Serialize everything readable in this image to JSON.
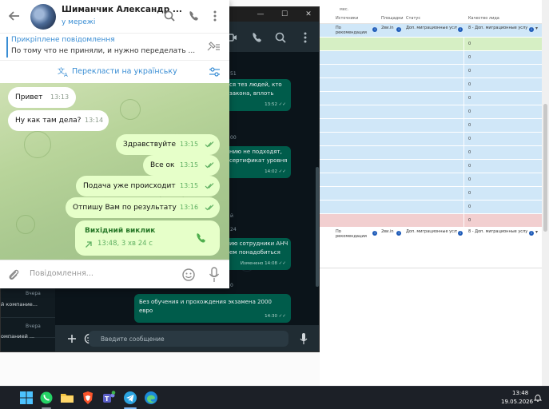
{
  "telegram": {
    "contact_name": "Шиманчик Александр ...",
    "contact_status": "у мережі",
    "pinned_title": "Прикріплене повідомлення",
    "pinned_text": "По тому что не приняли, и нужно переделать ...",
    "translate_label": "Перекласти на українську",
    "messages": [
      {
        "direction": "in",
        "text": "Привет",
        "time": "13:13"
      },
      {
        "direction": "in",
        "text": "Ну как там дела?",
        "time": "13:14"
      },
      {
        "direction": "out",
        "text": "Здравствуйте",
        "time": "13:15"
      },
      {
        "direction": "out",
        "text": "Все ок",
        "time": "13:15"
      },
      {
        "direction": "out",
        "text": "Подача уже происходит",
        "time": "13:15"
      },
      {
        "direction": "out",
        "text": "Отпишу Вам по результату",
        "time": "13:16"
      }
    ],
    "call": {
      "title": "Вихідний виклик",
      "info": "13:48, 3 хв 24 с"
    },
    "input_placeholder": "Повідомлення..."
  },
  "whatsapp": {
    "messages": [
      {
        "text": "ся тез людей, кто\nзакона, вплоть",
        "time": "13:52"
      },
      {
        "text": "нию не подходят,\nсертификат уровня",
        "time": "14:02"
      },
      {
        "text": "ию сотрудники АНЧ\nем понадобиться",
        "time": "Изменено 14:08"
      },
      {
        "text": "Без обучения и прохождения экзамена 2000 евро",
        "time": "14:30"
      }
    ],
    "date_fragments": [
      "51",
      "00",
      "й",
      "24",
      "0"
    ],
    "chat_list": [
      {
        "when": "Вчера",
        "preview": "й компание..."
      },
      {
        "when": "Вчера",
        "preview": "омпанией ..."
      }
    ],
    "input_placeholder": "Введите сообщение"
  },
  "crm": {
    "header_fragment": "мес.",
    "columns": [
      "Источники",
      "Площадки",
      "Статус",
      "Качество лида"
    ],
    "row_first": {
      "source": "По рекомендации",
      "platform": "2ви.in",
      "status": "Доп. миграционные услуги",
      "quality": "8 - Доп. миграционные услуги"
    },
    "zero_value": "0",
    "row_count": 16,
    "row_last": {
      "source": "По рекомендации",
      "platform": "2ви.in",
      "status": "Доп. миграционные услуги",
      "quality": "8 - Доп. миграционные услуги"
    },
    "colors": {
      "blue": "#d0e7f8",
      "green": "#d6efc4",
      "red": "#f2cfd0"
    }
  },
  "taskbar": {
    "time": "13:48",
    "date": "19.05.2026",
    "apps": [
      "windows-start",
      "whatsapp",
      "file-explorer",
      "brave-browser",
      "teams",
      "telegram",
      "edge"
    ]
  }
}
